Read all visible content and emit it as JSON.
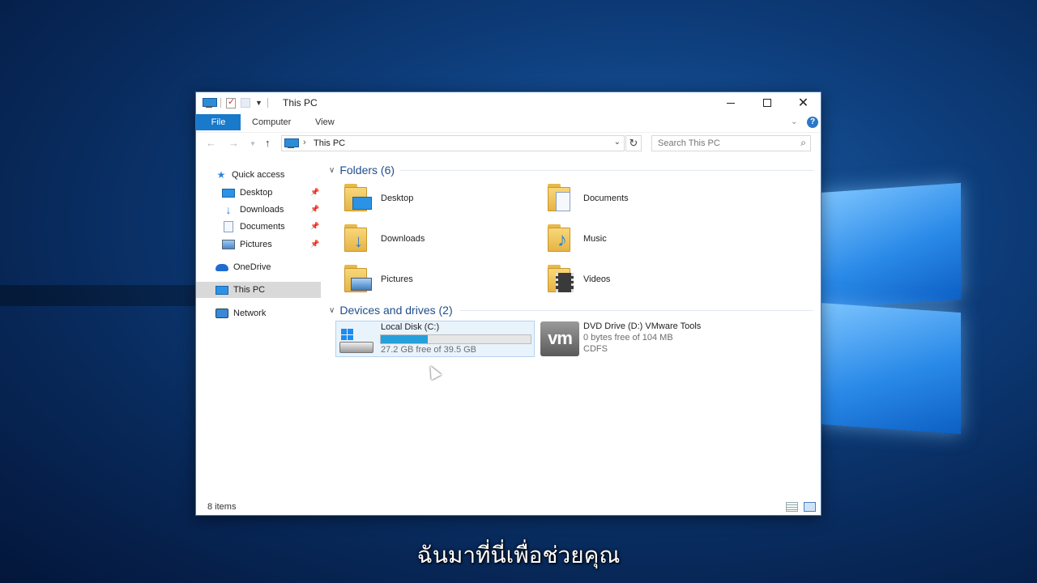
{
  "window": {
    "title": "This PC",
    "controls": {
      "minimize": "—",
      "maximize": "☐",
      "close": "✕"
    }
  },
  "ribbon": {
    "tabs": [
      {
        "label": "File"
      },
      {
        "label": "Computer"
      },
      {
        "label": "View"
      }
    ],
    "help": "?"
  },
  "address": {
    "crumbs": [
      "This PC"
    ],
    "search_placeholder": "Search This PC"
  },
  "sidebar": {
    "items": [
      {
        "label": "Quick access",
        "icon": "star-icon"
      },
      {
        "label": "Desktop",
        "icon": "desktop-icon",
        "pinned": true
      },
      {
        "label": "Downloads",
        "icon": "download-icon",
        "pinned": true
      },
      {
        "label": "Documents",
        "icon": "document-icon",
        "pinned": true
      },
      {
        "label": "Pictures",
        "icon": "pictures-icon",
        "pinned": true
      },
      {
        "label": "OneDrive",
        "icon": "cloud-icon"
      },
      {
        "label": "This PC",
        "icon": "computer-icon",
        "selected": true
      },
      {
        "label": "Network",
        "icon": "network-icon"
      }
    ]
  },
  "folders": {
    "header": "Folders (6)",
    "items": [
      {
        "label": "Desktop",
        "icon": "desktop-folder-icon"
      },
      {
        "label": "Documents",
        "icon": "documents-folder-icon"
      },
      {
        "label": "Downloads",
        "icon": "downloads-folder-icon"
      },
      {
        "label": "Music",
        "icon": "music-folder-icon"
      },
      {
        "label": "Pictures",
        "icon": "pictures-folder-icon"
      },
      {
        "label": "Videos",
        "icon": "videos-folder-icon"
      }
    ]
  },
  "drives": {
    "header": "Devices and drives (2)",
    "items": [
      {
        "name": "Local Disk (C:)",
        "free": "27.2 GB free of 39.5 GB",
        "used_fraction": 0.311,
        "icon": "hard-disk-icon"
      },
      {
        "name": "DVD Drive (D:) VMware Tools",
        "free": "0 bytes free of 104 MB",
        "fs": "CDFS",
        "icon": "vmware-icon",
        "logo_text": "vm"
      }
    ]
  },
  "status": {
    "item_count": "8 items"
  },
  "subtitle": "ฉันมาที่นี่เพื่อช่วยคุณ",
  "colors": {
    "accent": "#1979ca",
    "selection": "#d9d9d9",
    "progress": "#26a0da"
  }
}
